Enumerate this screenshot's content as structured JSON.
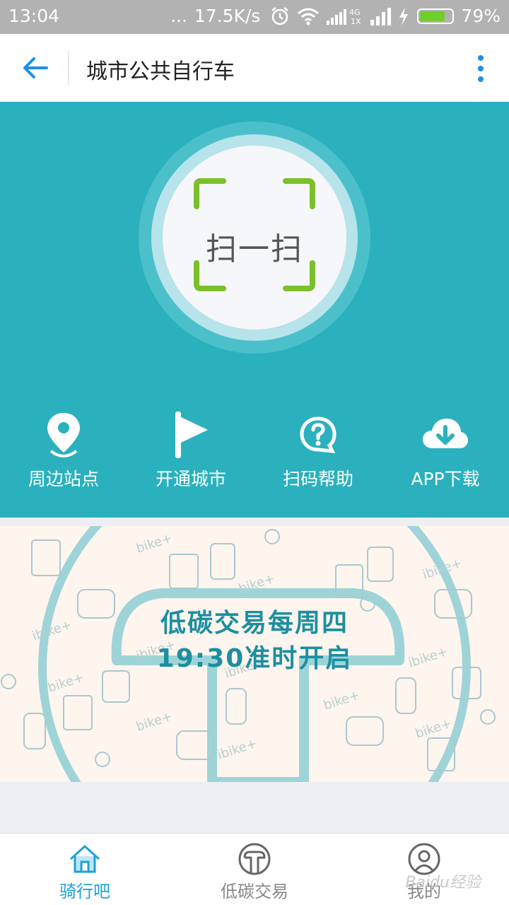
{
  "status_bar": {
    "time": "13:04",
    "dots": "...",
    "speed": "17.5K/s",
    "network_label": "4G\n1X",
    "battery_percent": "79%",
    "battery_level": 0.79
  },
  "app_bar": {
    "title": "城市公共自行车"
  },
  "scan": {
    "label": "扫一扫",
    "frame_color": "#7bbf2a"
  },
  "quick_actions": [
    {
      "label": "周边站点",
      "icon": "location-pin-icon"
    },
    {
      "label": "开通城市",
      "icon": "flag-icon"
    },
    {
      "label": "扫码帮助",
      "icon": "help-bubble-icon"
    },
    {
      "label": "APP下载",
      "icon": "cloud-download-icon"
    }
  ],
  "banner": {
    "line1": "低碳交易每周四",
    "line2": "19:30准时开启",
    "pattern_text": "ibike+"
  },
  "tab_bar": {
    "tabs": [
      {
        "label": "骑行吧",
        "icon": "home-icon",
        "active": true
      },
      {
        "label": "低碳交易",
        "icon": "t-logo-icon",
        "active": false
      },
      {
        "label": "我的",
        "icon": "user-icon",
        "active": false
      }
    ]
  },
  "watermark": "Baidu经验",
  "colors": {
    "primary": "#2ab1bd",
    "active_tab": "#1da1d8",
    "scan_green": "#7bbf2a"
  }
}
